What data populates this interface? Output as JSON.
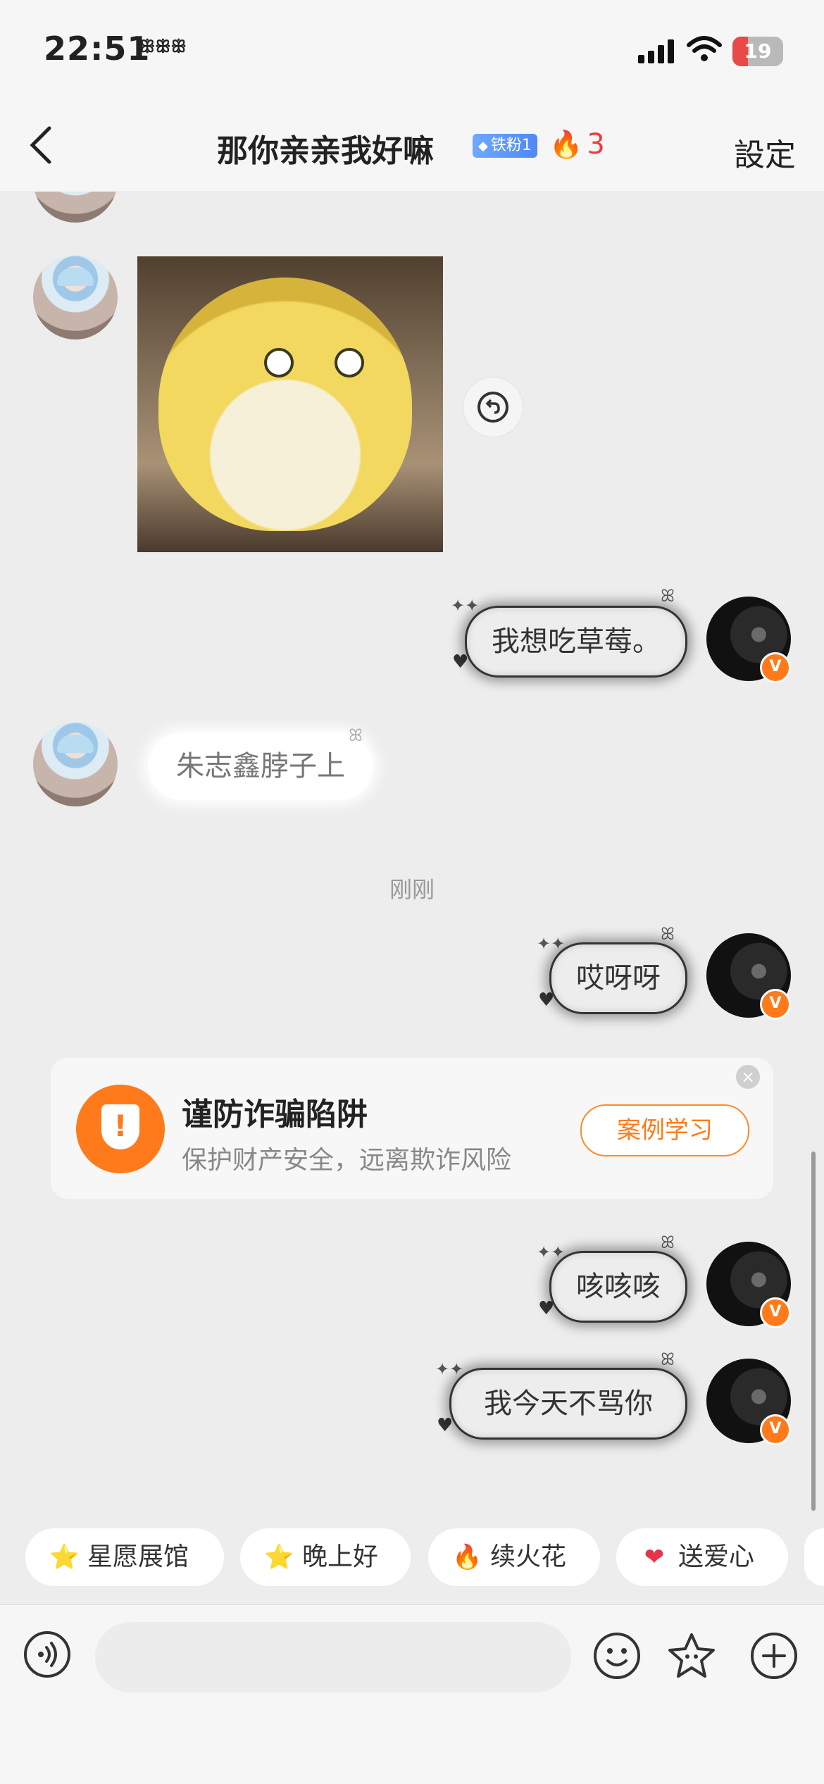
{
  "status_bar": {
    "time": "22:51",
    "time_extra": "ꕥꕥꕥ",
    "battery": "19"
  },
  "header": {
    "title": "那你亲亲我好嘛",
    "fan_badge": "铁粉1",
    "fire_count": "3",
    "settings": "設定"
  },
  "messages": {
    "me_1": "我想吃草莓。",
    "other_1": "朱志鑫脖子上",
    "divider": "刚刚",
    "me_2": "哎呀呀",
    "me_3": "咳咳咳",
    "me_4": "我今天不骂你"
  },
  "fraud_card": {
    "title": "谨防诈骗陷阱",
    "subtitle": "保护财产安全，远离欺诈风险",
    "button": "案例学习"
  },
  "quick_replies": [
    "星愿展馆",
    "晚上好",
    "续火花",
    "送爱心"
  ],
  "icons": {
    "back": "chevron-left-icon",
    "reply": "undo-icon",
    "voice": "voice-icon",
    "emoji": "emoji-icon",
    "sticker": "star-icon",
    "plus": "plus-icon"
  },
  "colors": {
    "accent": "#ff7a1a",
    "fire": "#ef3b3b",
    "badge": "#4f88f5"
  }
}
